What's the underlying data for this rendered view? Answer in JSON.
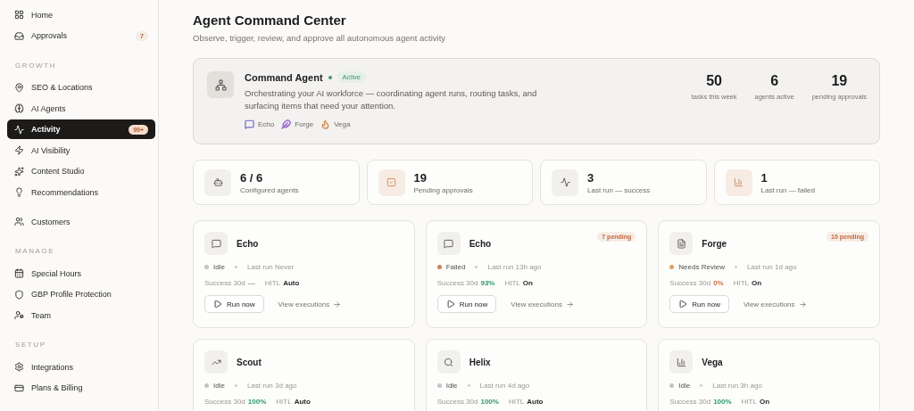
{
  "sidebar": {
    "sections": [
      {
        "items": [
          {
            "label": "Home",
            "selected": false
          },
          {
            "label": "Approvals",
            "selected": false,
            "badge": "7"
          }
        ]
      },
      {
        "heading": "GROWTH",
        "items": [
          {
            "label": "SEO & Locations",
            "selected": false
          },
          {
            "label": "AI Agents",
            "selected": false
          },
          {
            "label": "Activity",
            "selected": true,
            "badge": "99+"
          },
          {
            "label": "AI Visibility",
            "selected": false
          },
          {
            "label": "Content Studio",
            "selected": false
          },
          {
            "label": "Recommendations",
            "selected": false
          }
        ]
      },
      {
        "items": [
          {
            "label": "Customers",
            "selected": false
          }
        ]
      },
      {
        "heading": "MANAGE",
        "items": [
          {
            "label": "Special Hours",
            "selected": false
          },
          {
            "label": "GBP Profile Protection",
            "selected": false
          },
          {
            "label": "Team",
            "selected": false
          }
        ]
      },
      {
        "heading": "SETUP",
        "items": [
          {
            "label": "Integrations",
            "selected": false
          },
          {
            "label": "Plans & Billing",
            "selected": false
          }
        ]
      }
    ]
  },
  "header": {
    "title": "Agent Command Center",
    "subtitle": "Observe, trigger, review, and approve all autonomous agent activity"
  },
  "command_agent": {
    "name": "Command Agent",
    "status": "Active",
    "description": "Orchestrating your AI workforce — coordinating agent runs, routing tasks, and surfacing items that need your attention.",
    "tags": [
      {
        "label": "Echo",
        "color": "#8b7fd6"
      },
      {
        "label": "Forge",
        "color": "#9a6fd0"
      },
      {
        "label": "Vega",
        "color": "#d9925a"
      }
    ],
    "stats": [
      {
        "value": "50",
        "label": "tasks this week"
      },
      {
        "value": "6",
        "label": "agents active"
      },
      {
        "value": "19",
        "label": "pending approvals"
      }
    ]
  },
  "summary": [
    {
      "value": "6 / 6",
      "label": "Configured agents"
    },
    {
      "value": "19",
      "label": "Pending approvals"
    },
    {
      "value": "3",
      "label": "Last run — success"
    },
    {
      "value": "1",
      "label": "Last run — failed"
    }
  ],
  "agents": [
    {
      "name": "Echo",
      "status": {
        "label": "Idle",
        "color": "#c4c4c4"
      },
      "last_run": "Last run Never",
      "success_label": "Success 30d",
      "success": {
        "value": "—",
        "kind": "plain"
      },
      "hitl_label": "HITL",
      "hitl": "Auto",
      "run_label": "Run now",
      "view_label": "View executions"
    },
    {
      "name": "Echo",
      "pending": "7 pending",
      "status": {
        "label": "Failed",
        "color": "#c9825a"
      },
      "last_run": "Last run 13h ago",
      "success_label": "Success 30d",
      "success": {
        "value": "93%",
        "kind": "good"
      },
      "hitl_label": "HITL",
      "hitl": "On",
      "run_label": "Run now",
      "view_label": "View executions"
    },
    {
      "name": "Forge",
      "pending": "10 pending",
      "status": {
        "label": "Needs Review",
        "color": "#e0a060"
      },
      "last_run": "Last run 1d ago",
      "success_label": "Success 30d",
      "success": {
        "value": "0%",
        "kind": "bad"
      },
      "hitl_label": "HITL",
      "hitl": "On",
      "run_label": "Run now",
      "view_label": "View executions"
    },
    {
      "name": "Scout",
      "status": {
        "label": "Idle",
        "color": "#c4c4c4"
      },
      "last_run": "Last run 3d ago",
      "success_label": "Success 30d",
      "success": {
        "value": "100%",
        "kind": "good"
      },
      "hitl_label": "HITL",
      "hitl": "Auto"
    },
    {
      "name": "Helix",
      "status": {
        "label": "Idle",
        "color": "#c4c4c4"
      },
      "last_run": "Last run 4d ago",
      "success_label": "Success 30d",
      "success": {
        "value": "100%",
        "kind": "good"
      },
      "hitl_label": "HITL",
      "hitl": "Auto"
    },
    {
      "name": "Vega",
      "status": {
        "label": "Idle",
        "color": "#c4c4c4"
      },
      "last_run": "Last run 3h ago",
      "success_label": "Success 30d",
      "success": {
        "value": "100%",
        "kind": "good"
      },
      "hitl_label": "HITL",
      "hitl": "On"
    }
  ]
}
